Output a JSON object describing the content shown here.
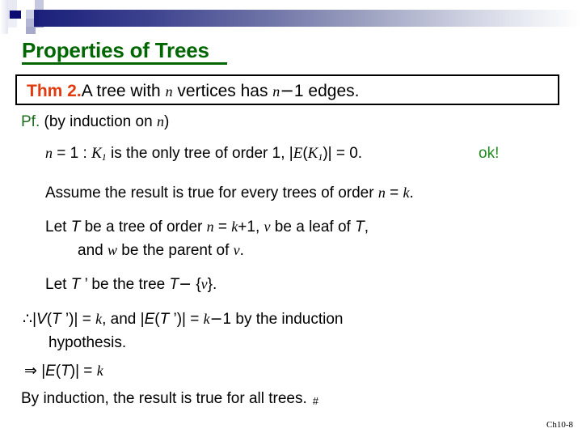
{
  "slide": {
    "title": "Properties of Trees",
    "title_color": "#006600",
    "accent_color": "#E03C10",
    "header_bar_color": "#1b1f7a",
    "footer_ref": "Ch10-8"
  },
  "theorem": {
    "label": "Thm 2.",
    "text_a": "A tree with ",
    "var_n": "n",
    "text_b": " vertices has ",
    "var_n2": "n",
    "minus": "−",
    "one": "1",
    "text_c": " edges."
  },
  "proof": {
    "pf_label": "Pf.",
    "pf_text_a": " (by induction on ",
    "pf_var": "n",
    "pf_text_b": ")",
    "base_var_n": "n",
    "base_eq1": " = 1  : ",
    "base_K": "K",
    "base_K_sub": "1",
    "base_text_a": " is the only tree of order 1, |",
    "base_E": "E",
    "base_paren_open": "(",
    "base_K2": "K",
    "base_K2_sub": "1",
    "base_paren_close": ")",
    "base_text_b": "| = 0.",
    "base_ok": "ok!",
    "assume_a": "Assume the result is true for every trees of order ",
    "assume_n": "n",
    "assume_b": " = ",
    "assume_k": "k",
    "assume_c": ".",
    "let1_a": "Let ",
    "let1_T": "T",
    "let1_b": " be a tree of order ",
    "let1_n": "n",
    "let1_c": " = ",
    "let1_k": "k",
    "let1_d": "+1, ",
    "let1_v": "v",
    "let1_e": " be a leaf of ",
    "let1_T2": "T",
    "let1_f": ",",
    "let2_a": "and ",
    "let2_w": "w",
    "let2_b": " be the parent of ",
    "let2_v": "v",
    "let2_c": ".",
    "let3_a": "Let ",
    "let3_T": "T",
    "let3_prime": " ’",
    "let3_b": " be the tree  ",
    "let3_T2": "T",
    "let3_minus": "−",
    "let3_c": " {",
    "let3_v": "v",
    "let3_d": "}.",
    "ind_therefore": "∴",
    "ind_a": "|",
    "ind_V": "V",
    "ind_b": "(",
    "ind_T": "T",
    "ind_prime": " ’",
    "ind_c": ")| = ",
    "ind_k": "k",
    "ind_d": ", and |",
    "ind_E": "E",
    "ind_e": "(",
    "ind_T2": "T",
    "ind_prime2": " ’",
    "ind_f": ")| = ",
    "ind_k2": "k",
    "ind_minus": "−",
    "ind_one": "1",
    "ind_g": "  by the induction",
    "ind_h": "hypothesis.",
    "imp_arrow": "⇒",
    "imp_a": " |",
    "imp_E": "E",
    "imp_b": "(",
    "imp_T": "T",
    "imp_c": ")| = ",
    "imp_k": "k",
    "final_text": "By induction, the result is true for all trees.",
    "final_qed": "#"
  }
}
